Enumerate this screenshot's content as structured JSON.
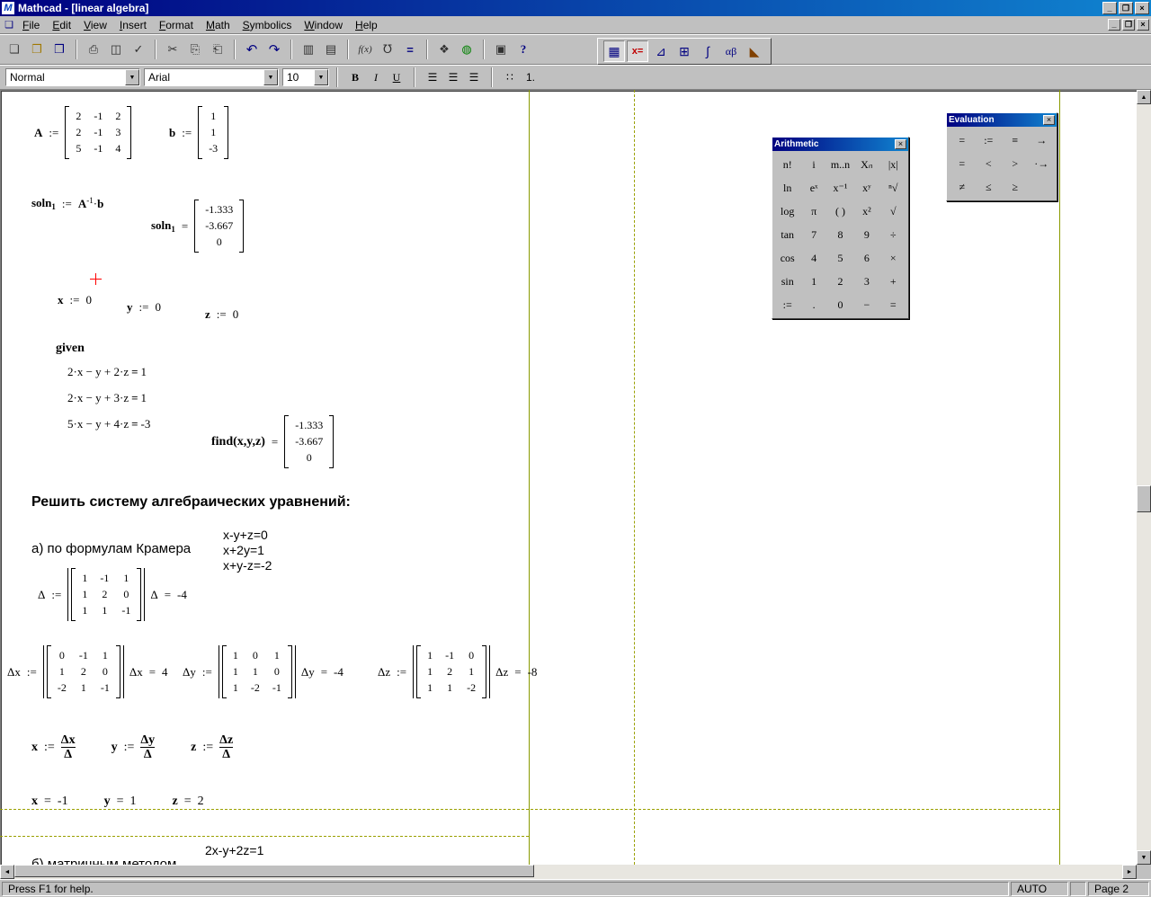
{
  "window": {
    "title": "Mathcad - [linear algebra]",
    "logo": "M"
  },
  "chrome": {
    "minimize": "_",
    "maximize": "❐",
    "restore": "❐",
    "close": "×",
    "dropdown": "▼",
    "up": "▲",
    "down": "▼",
    "left": "◄",
    "right": "►",
    "doc": "❏"
  },
  "colors": {
    "titlebar_start": "#000080",
    "titlebar_end": "#1084d0",
    "guide": "#8a9a00",
    "cursor": "#ff0000"
  },
  "menubar": {
    "items": [
      "File",
      "Edit",
      "View",
      "Insert",
      "Format",
      "Math",
      "Symbolics",
      "Window",
      "Help"
    ]
  },
  "toolbars": {
    "g1": [
      {
        "name": "new",
        "glyph": "❏"
      },
      {
        "name": "open",
        "glyph": "❐"
      },
      {
        "name": "save",
        "glyph": "❒"
      }
    ],
    "g2": [
      {
        "name": "print",
        "glyph": "⎙"
      },
      {
        "name": "print-preview",
        "glyph": "◫"
      },
      {
        "name": "spell-check",
        "glyph": "✓"
      }
    ],
    "g3": [
      {
        "name": "cut",
        "glyph": "✂"
      },
      {
        "name": "copy",
        "glyph": "⎘"
      },
      {
        "name": "paste",
        "glyph": "⎗"
      }
    ],
    "g4": [
      {
        "name": "undo",
        "glyph": "↶"
      },
      {
        "name": "redo",
        "glyph": "↷"
      }
    ],
    "g5": [
      {
        "name": "align-across",
        "glyph": "▥"
      },
      {
        "name": "align-down",
        "glyph": "▤"
      }
    ],
    "g6": [
      {
        "name": "insert-function",
        "glyph": "f(x)"
      },
      {
        "name": "insert-unit",
        "glyph": "℧"
      },
      {
        "name": "calculate",
        "glyph": "="
      }
    ],
    "g7": [
      {
        "name": "component",
        "glyph": "❖"
      },
      {
        "name": "mathconnex",
        "glyph": "◍"
      }
    ],
    "g8": [
      {
        "name": "resource-center",
        "glyph": "▣"
      },
      {
        "name": "help",
        "glyph": "?"
      }
    ],
    "math": [
      {
        "name": "arithmetic-toolbar",
        "glyph": "▦",
        "active": "true"
      },
      {
        "name": "evaluation-toolbar",
        "glyph": "x=",
        "active": "true"
      },
      {
        "name": "graph-toolbar",
        "glyph": "⊿",
        "active": "false"
      },
      {
        "name": "matrix-toolbar",
        "glyph": "⊞",
        "active": "false"
      },
      {
        "name": "calculus-toolbar",
        "glyph": "∫",
        "active": "false"
      },
      {
        "name": "greek-toolbar",
        "glyph": "αβ",
        "active": "false"
      },
      {
        "name": "symbolics-toolbar",
        "glyph": "◣",
        "active": "false"
      }
    ]
  },
  "format": {
    "style": "Normal",
    "font": "Arial",
    "size": "10",
    "buttons": [
      {
        "name": "bold-button",
        "glyph": "B"
      },
      {
        "name": "italic-button",
        "glyph": "I"
      },
      {
        "name": "underline-button",
        "glyph": "U"
      }
    ],
    "aligns": [
      {
        "name": "align-left-button",
        "glyph": "☰"
      },
      {
        "name": "align-center-button",
        "glyph": "☰"
      },
      {
        "name": "align-right-button",
        "glyph": "☰"
      }
    ],
    "lists": [
      {
        "name": "bullet-list-button",
        "glyph": "∷"
      },
      {
        "name": "numbered-list-button",
        "glyph": "1."
      }
    ]
  },
  "palettes": {
    "arithmetic": {
      "title": "Arithmetic",
      "close": "×",
      "keys": [
        "n!",
        "i",
        "m..n",
        "Xₙ",
        "|x|",
        "ln",
        "eˣ",
        "x⁻¹",
        "xʸ",
        "ⁿ√",
        "log",
        "π",
        "( )",
        "x²",
        "√",
        "tan",
        "7",
        "8",
        "9",
        "÷",
        "cos",
        "4",
        "5",
        "6",
        "×",
        "sin",
        "1",
        "2",
        "3",
        "+",
        ":=",
        ".",
        "0",
        "−",
        "="
      ]
    },
    "evaluation": {
      "title": "Evaluation",
      "close": "×",
      "keys": [
        "=",
        ":=",
        "≡",
        "→",
        "=",
        "<",
        ">",
        "·→",
        "≠",
        "≤",
        "≥"
      ]
    }
  },
  "sheet": {
    "sym": {
      "assign": ":=",
      "eq": "="
    },
    "A": {
      "name": "A",
      "cells": [
        "2",
        "-1",
        "2",
        "2",
        "-1",
        "3",
        "5",
        "-1",
        "4"
      ]
    },
    "b": {
      "name": "b",
      "cells": [
        "1",
        "1",
        "-3"
      ]
    },
    "soln_def": {
      "name": "soln",
      "sub": "1",
      "base": "A",
      "sup": "-1",
      "mult": "·",
      "operand": "b"
    },
    "soln_eval": {
      "name": "soln",
      "sub": "1",
      "cells": [
        "-1.333",
        "-3.667",
        "0"
      ]
    },
    "defs": [
      {
        "v": "x",
        "val": "0"
      },
      {
        "v": "y",
        "val": "0"
      },
      {
        "v": "z",
        "val": "0"
      }
    ],
    "given_label": "given",
    "eqs": [
      {
        "lhs": "2·x − y + 2·z",
        "eq": "=",
        "rhs": "1"
      },
      {
        "lhs": "2·x − y + 3·z",
        "eq": "=",
        "rhs": "1"
      },
      {
        "lhs": "5·x − y + 4·z",
        "eq": "=",
        "rhs": "-3"
      }
    ],
    "find": {
      "fn": "find(x,y,z)",
      "cells": [
        "-1.333",
        "-3.667",
        "0"
      ]
    },
    "heading": "Решить систему алгебраических уравнений:",
    "part_a": "а) по формулам Крамера",
    "system_a": [
      "x-y+z=0",
      "x+2y=1",
      "x+y-z=-2"
    ],
    "delta": {
      "name": "Δ",
      "cells": [
        "1",
        "-1",
        "1",
        "1",
        "2",
        "0",
        "1",
        "1",
        "-1"
      ],
      "res": {
        "name": "Δ",
        "val": "-4"
      }
    },
    "dx": {
      "name": "Δx",
      "cells": [
        "0",
        "-1",
        "1",
        "1",
        "2",
        "0",
        "-2",
        "1",
        "-1"
      ],
      "res": {
        "name": "Δx",
        "val": "4"
      }
    },
    "dy": {
      "name": "Δy",
      "cells": [
        "1",
        "0",
        "1",
        "1",
        "1",
        "0",
        "1",
        "-2",
        "-1"
      ],
      "res": {
        "name": "Δy",
        "val": "-4"
      }
    },
    "dz": {
      "name": "Δz",
      "cells": [
        "1",
        "-1",
        "0",
        "1",
        "2",
        "1",
        "1",
        "1",
        "-2"
      ],
      "res": {
        "name": "Δz",
        "val": "-8"
      }
    },
    "fracs": [
      {
        "v": "x",
        "assign": ":=",
        "num": "Δx",
        "den": "Δ"
      },
      {
        "v": "y",
        "assign": ":=",
        "num": "Δy",
        "den": "Δ"
      },
      {
        "v": "z",
        "assign": ":=",
        "num": "Δz",
        "den": "Δ"
      }
    ],
    "results": [
      {
        "v": "x",
        "eq": "=",
        "val": "-1"
      },
      {
        "v": "y",
        "eq": "=",
        "val": "1"
      },
      {
        "v": "z",
        "eq": "=",
        "val": "2"
      }
    ],
    "system_b_line": "2x-y+2z=1",
    "part_b": "б) матричным методом"
  },
  "statusbar": {
    "help": "Press F1 for help.",
    "auto": "AUTO",
    "page": "Page 2"
  }
}
